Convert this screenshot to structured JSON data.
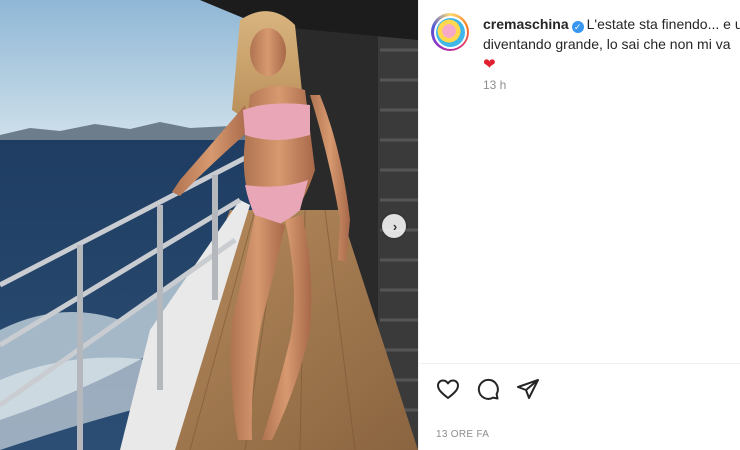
{
  "post": {
    "username": "cremaschina",
    "verified_icon": "verified-badge-icon",
    "caption_line1": "L'estate sta finendo... e un",
    "caption_line2": "diventando grande, lo sai che non mi va",
    "caption_emoji": "❤",
    "relative_time": "13 h",
    "timestamp": "13 ORE FA"
  },
  "media": {
    "next_icon": "chevron-right-icon",
    "next_glyph": "›"
  },
  "actions": [
    {
      "name": "like",
      "icon": "heart-icon"
    },
    {
      "name": "comment",
      "icon": "comment-icon"
    },
    {
      "name": "share",
      "icon": "share-icon"
    }
  ],
  "colors": {
    "verified": "#3897f0",
    "text": "#262626",
    "muted": "#8e8e8e",
    "heart": "#e0202f"
  }
}
